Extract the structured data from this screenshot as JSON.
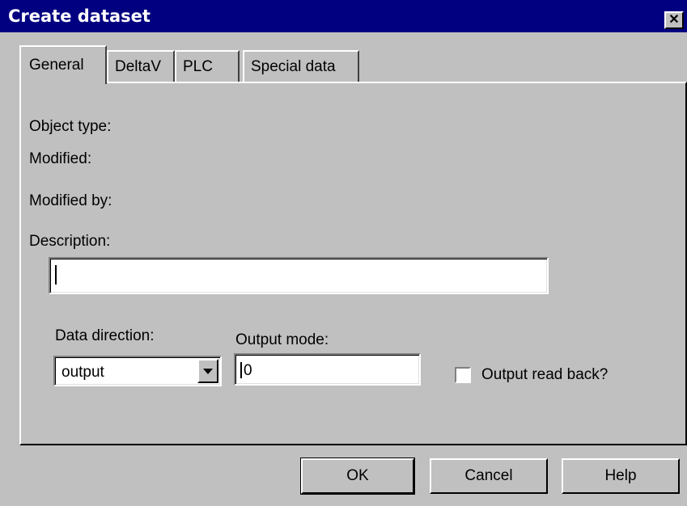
{
  "window": {
    "title": "Create dataset",
    "close_symbol": "✕"
  },
  "tabs": [
    "General",
    "DeltaV",
    "PLC",
    "Special data"
  ],
  "general": {
    "object_type_label": "Object type:",
    "modified_label": "Modified:",
    "modified_by_label": "Modified by:",
    "description_label": "Description:",
    "description_value": "",
    "data_direction_label": "Data direction:",
    "data_direction_value": "output",
    "output_mode_label": "Output mode:",
    "output_mode_value": "0",
    "output_read_back_label": "Output read back?",
    "output_read_back_checked": false
  },
  "buttons": {
    "ok": "OK",
    "cancel": "Cancel",
    "help": "Help"
  }
}
